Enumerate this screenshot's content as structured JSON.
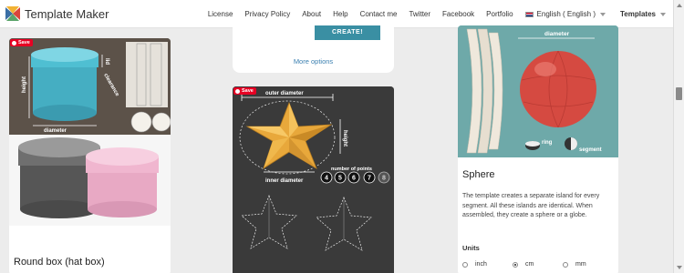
{
  "header": {
    "site_title": "Template Maker",
    "nav": [
      "License",
      "Privacy Policy",
      "About",
      "Help",
      "Contact me",
      "Twitter",
      "Facebook",
      "Portfolio"
    ],
    "language": "English ( English )",
    "templates": "Templates"
  },
  "pin_save_label": "Save",
  "round_box": {
    "title": "Round box (hat box)",
    "labels": {
      "height": "height",
      "lid": "lid",
      "clearance": "clearance",
      "diameter": "diameter"
    }
  },
  "form": {
    "create_label": "CREATE!",
    "more_options": "More options"
  },
  "star": {
    "labels": {
      "outer_diameter": "outer diameter",
      "inner_diameter": "inner diameter",
      "height": "height",
      "number_of_points": "number of points"
    },
    "point_options": [
      "4",
      "5",
      "6",
      "7",
      "8"
    ]
  },
  "sphere": {
    "title": "Sphere",
    "description": "The template creates a separate island for every segment. All these islands are identical. When assembled, they create a sphere or a globe.",
    "labels": {
      "diameter": "diameter",
      "ring": "ring",
      "segment": "segment"
    },
    "units_label": "Units",
    "units": [
      {
        "label": "inch",
        "checked": false
      },
      {
        "label": "cm",
        "checked": true
      },
      {
        "label": "mm",
        "checked": false
      }
    ]
  },
  "colors": {
    "accent": "#3a8fa3",
    "pinterest": "#e60023",
    "box_cyan": "#4db6c9",
    "star_orange": "#e7a63a",
    "sphere_red": "#d94a42",
    "sphere_bg": "#6ea9a9"
  }
}
